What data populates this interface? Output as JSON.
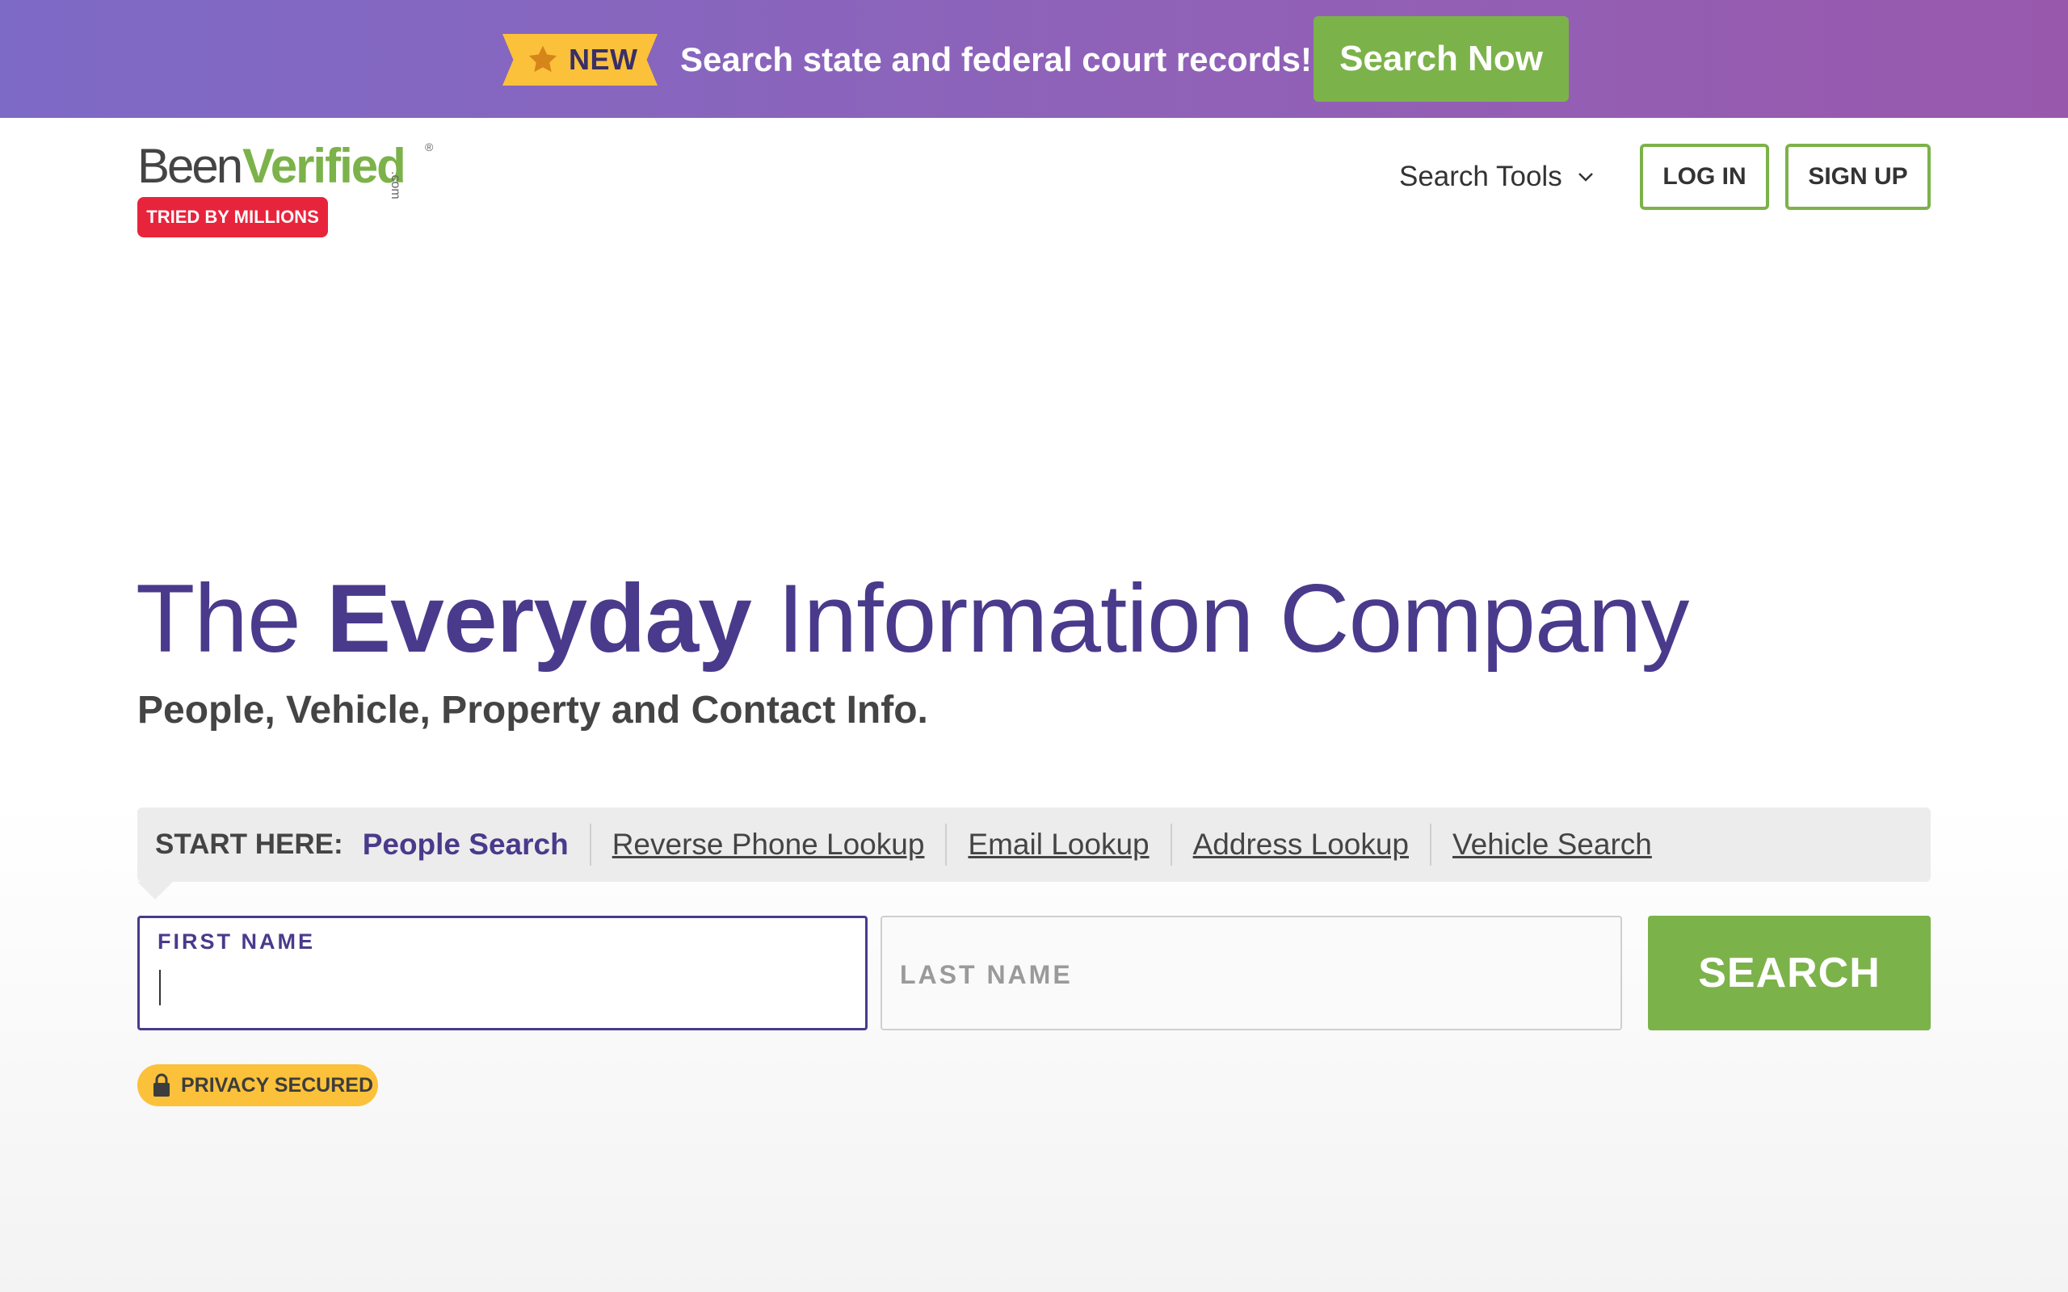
{
  "promo": {
    "badge": "NEW",
    "text": "Search state and federal court records!",
    "button": "Search Now",
    "star_icon": "star-icon"
  },
  "header": {
    "logo": {
      "part1": "Been",
      "part2": "Verified",
      "dotcom": ".com",
      "reg": "®"
    },
    "tagline_badge": "TRIED BY MILLIONS",
    "nav": {
      "search_tools": "Search Tools"
    },
    "login": "LOG IN",
    "signup": "SIGN UP"
  },
  "hero": {
    "title_pre": "The",
    "title_bold": "Everyday",
    "title_post": "Information Company",
    "subtitle": "People, Vehicle, Property and Contact Info."
  },
  "search": {
    "lead": "START HERE:",
    "tabs": [
      {
        "label": "People Search",
        "active": true
      },
      {
        "label": "Reverse Phone Lookup",
        "active": false
      },
      {
        "label": "Email Lookup",
        "active": false
      },
      {
        "label": "Address Lookup",
        "active": false
      },
      {
        "label": "Vehicle Search",
        "active": false
      }
    ],
    "first_name_label": "FIRST NAME",
    "first_name_value": "",
    "last_name_placeholder": "LAST NAME",
    "button": "SEARCH"
  },
  "privacy": {
    "label": "PRIVACY SECURED",
    "icon": "lock-icon"
  },
  "colors": {
    "brand_green": "#7cb24a",
    "brand_purple": "#4a3a8c",
    "badge_red": "#e8243c",
    "badge_yellow": "#fcc13a"
  }
}
